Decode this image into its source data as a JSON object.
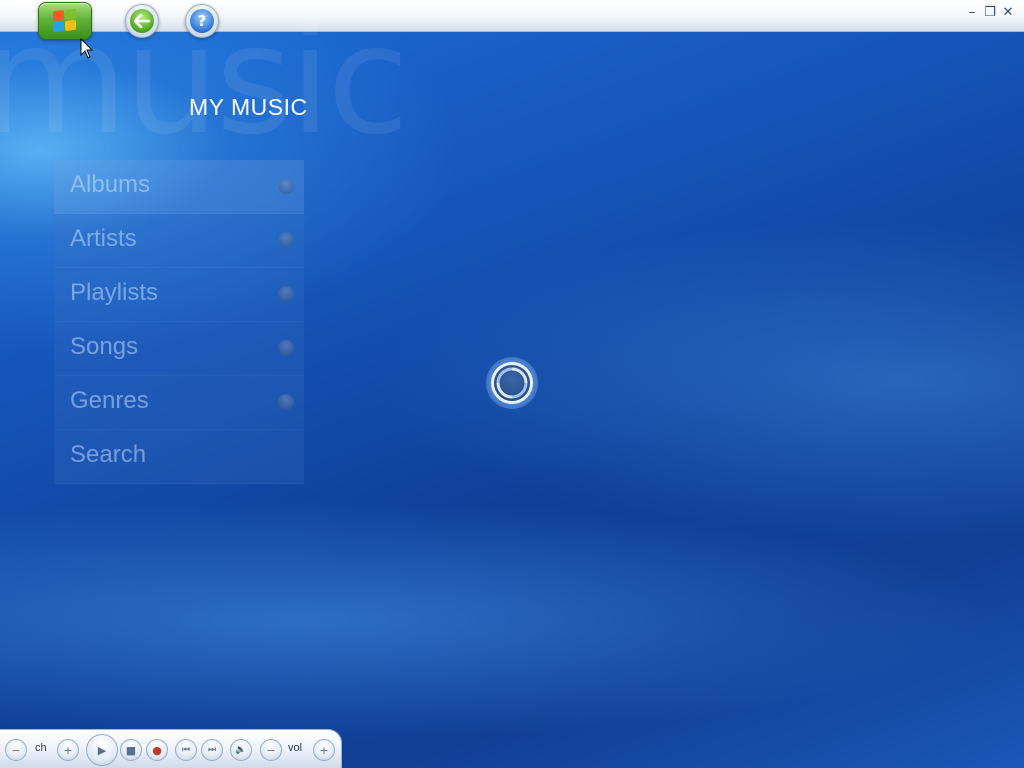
{
  "window": {
    "controls": {
      "minimize": "–",
      "restore": "❐",
      "close": "✕"
    }
  },
  "toolbar": {
    "start_icon": "windows-flag-icon",
    "back_icon": "back-arrow-icon",
    "help_label": "?"
  },
  "header": {
    "watermark": "music",
    "title": "MY MUSIC"
  },
  "menu": {
    "items": [
      {
        "label": "Albums",
        "has_indicator": true,
        "focused": true
      },
      {
        "label": "Artists",
        "has_indicator": true,
        "focused": false
      },
      {
        "label": "Playlists",
        "has_indicator": true,
        "focused": false
      },
      {
        "label": "Songs",
        "has_indicator": true,
        "focused": false
      },
      {
        "label": "Genres",
        "has_indicator": true,
        "focused": false
      },
      {
        "label": "Search",
        "has_indicator": false,
        "focused": false
      }
    ]
  },
  "status": {
    "loading_icon": "loading-spinner-icon"
  },
  "transport": {
    "ch_label": "ch",
    "vol_label": "vol",
    "minus": "−",
    "plus": "+",
    "play": "▶",
    "stop": "■",
    "record": "●",
    "prev": "⏮",
    "next": "⏭",
    "mute": "🔈"
  }
}
